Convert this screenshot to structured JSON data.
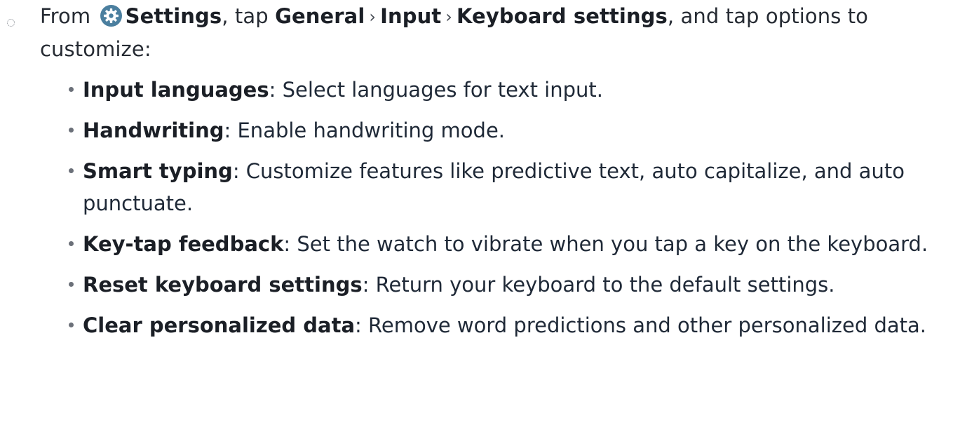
{
  "step": {
    "prefix": "From ",
    "settings_label": "Settings",
    "tap_text": ", tap ",
    "path": [
      "General",
      "Input",
      "Keyboard settings"
    ],
    "path_separator": "›",
    "suffix": ", and tap options to customize:",
    "icon": "settings-gear-icon",
    "icon_color": "#4b7f9f"
  },
  "options": [
    {
      "term": "Input languages",
      "desc": ": Select languages for text input."
    },
    {
      "term": "Handwriting",
      "desc": ": Enable handwriting mode."
    },
    {
      "term": "Smart typing",
      "desc": ": Customize features like predictive text, auto capitalize, and auto punctuate."
    },
    {
      "term": "Key-tap feedback",
      "desc": ": Set the watch to vibrate when you tap a key on the keyboard."
    },
    {
      "term": "Reset keyboard settings",
      "desc": ": Return your keyboard to the default settings."
    },
    {
      "term": "Clear personalized data",
      "desc": ": Remove word predictions and other personalized data."
    }
  ]
}
